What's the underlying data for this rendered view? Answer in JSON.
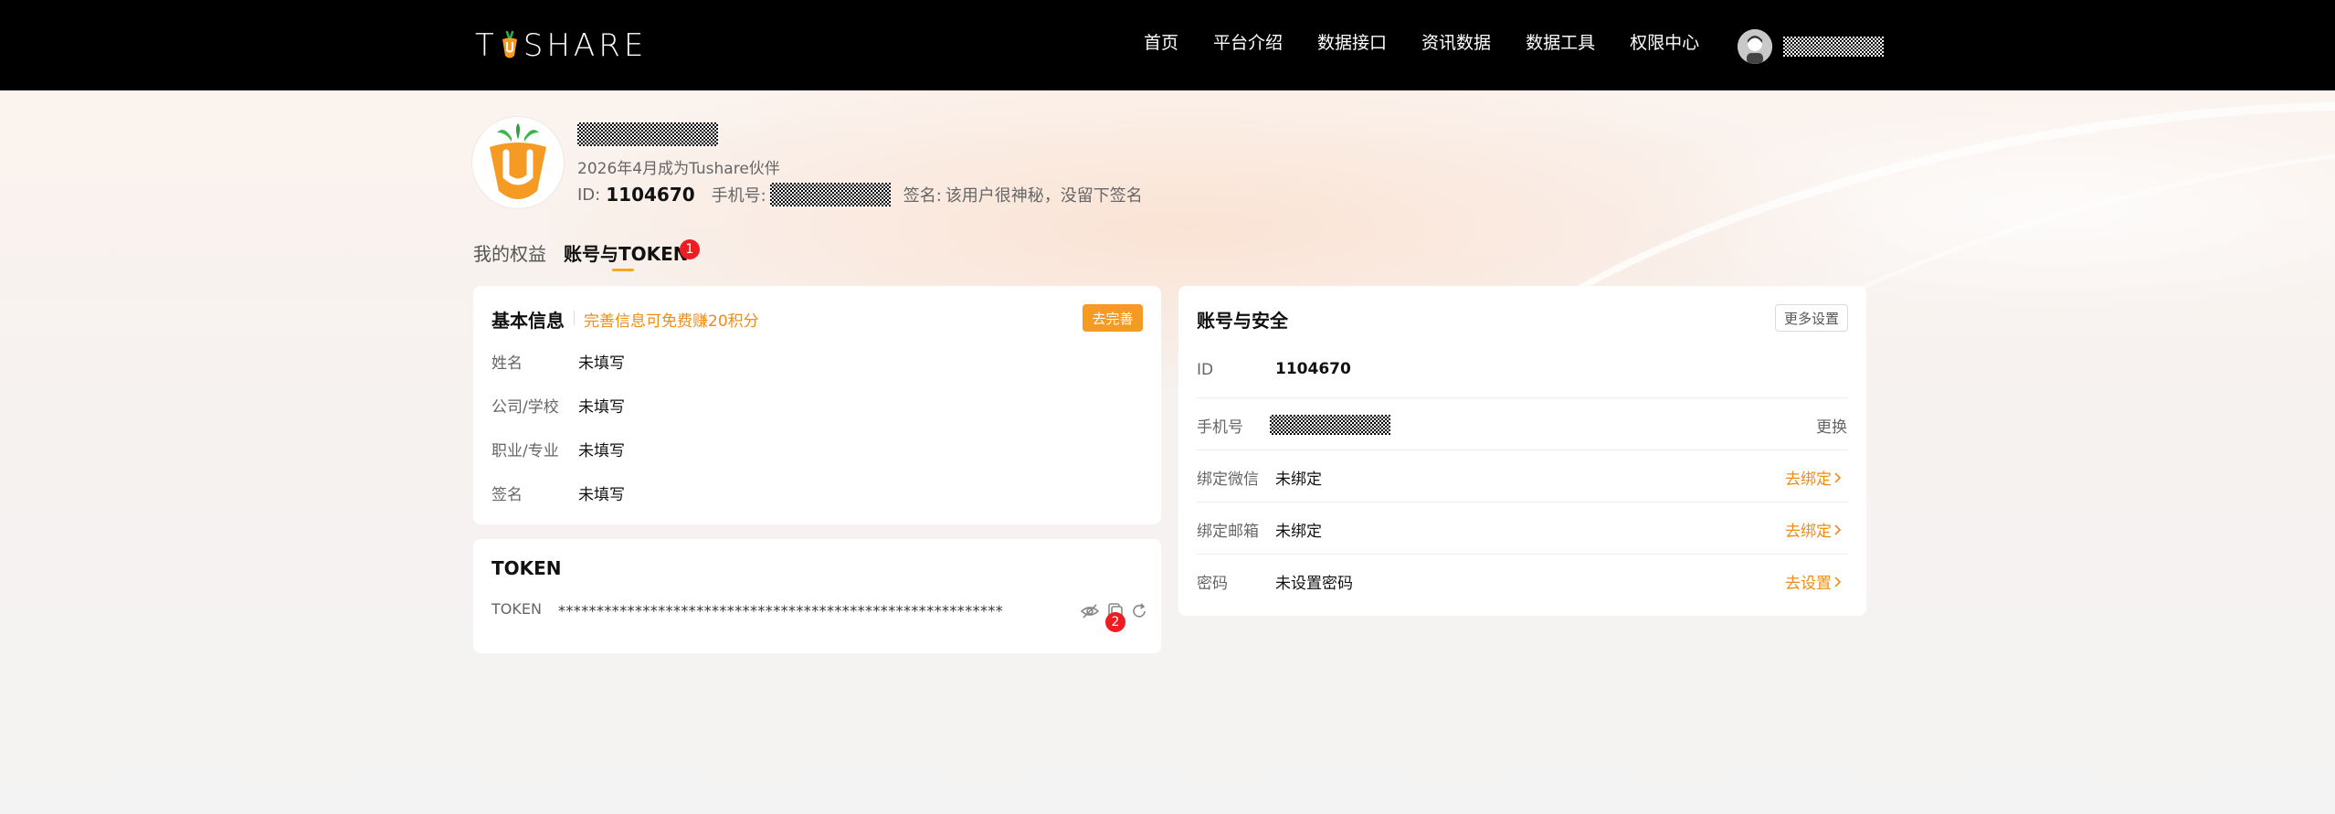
{
  "header": {
    "logo_text_left": "T",
    "logo_text_right": "SHARE",
    "nav": [
      "首页",
      "平台介绍",
      "数据接口",
      "资讯数据",
      "数据工具",
      "权限中心"
    ]
  },
  "profile": {
    "since": "2026年4月成为Tushare伙伴",
    "id_label": "ID:",
    "id_value": "1104670",
    "phone_label": "手机号:",
    "signature_label": "签名:",
    "signature_value": "该用户很神秘，没留下签名"
  },
  "tabs": [
    {
      "label": "我的权益"
    },
    {
      "label": "账号与TOKEN",
      "badge": "1"
    }
  ],
  "basic_info": {
    "title": "基本信息",
    "hint": "完善信息可免费赚20积分",
    "button": "去完善",
    "rows": [
      {
        "label": "姓名",
        "value": "未填写"
      },
      {
        "label": "公司/学校",
        "value": "未填写"
      },
      {
        "label": "职业/专业",
        "value": "未填写"
      },
      {
        "label": "签名",
        "value": "未填写"
      }
    ]
  },
  "token": {
    "title": "TOKEN",
    "label": "TOKEN",
    "masked": "**********************************************************",
    "copy_badge": "2",
    "icons": [
      "eye-off-icon",
      "copy-icon",
      "refresh-icon"
    ]
  },
  "security": {
    "title": "账号与安全",
    "more_button": "更多设置",
    "rows": [
      {
        "label": "ID",
        "value": "1104670",
        "action": ""
      },
      {
        "label": "手机号",
        "value": "",
        "action": "更换"
      },
      {
        "label": "绑定微信",
        "value": "未绑定",
        "action": "去绑定"
      },
      {
        "label": "绑定邮箱",
        "value": "未绑定",
        "action": "去绑定"
      },
      {
        "label": "密码",
        "value": "未设置密码",
        "action": "去设置"
      }
    ]
  },
  "colors": {
    "accent": "#f59a23",
    "accent_text": "#f08c16",
    "badge": "#ee1d23",
    "header_bg": "#000000"
  }
}
